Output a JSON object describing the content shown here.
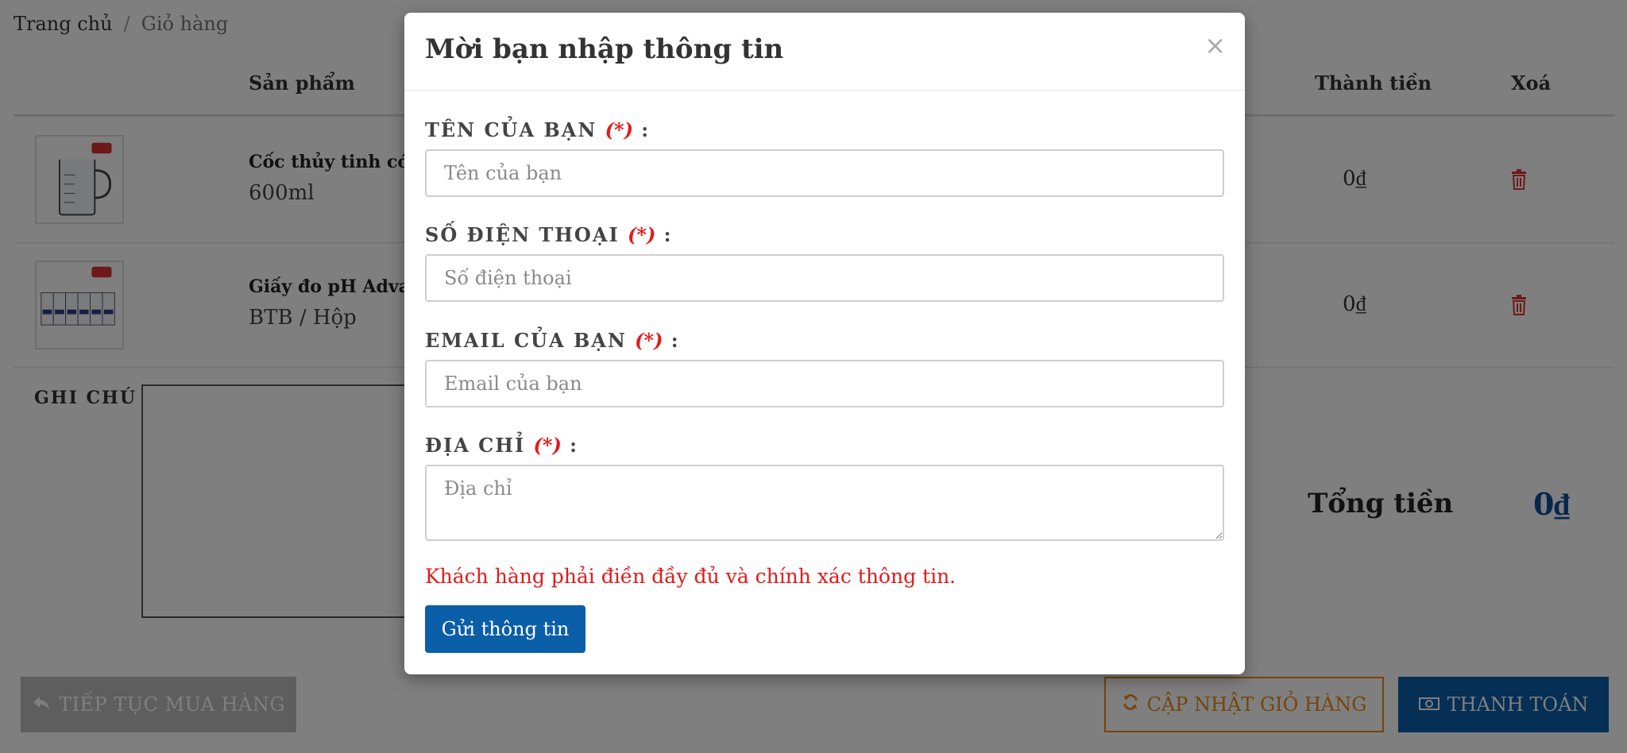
{
  "breadcrumb": {
    "home": "Trang chủ",
    "separator": "/",
    "current": "Giỏ hàng"
  },
  "table": {
    "headers": {
      "product": "Sản phẩm",
      "subtotal": "Thành tiền",
      "delete": "Xoá"
    },
    "rows": [
      {
        "name": "Cốc thủy tinh có q",
        "variant": "600ml",
        "subtotal": "0₫"
      },
      {
        "name": "Giấy đo pH Advan",
        "variant": "BTB / Hộp",
        "subtotal": "0₫"
      }
    ]
  },
  "note": {
    "label": "GHI CHÚ"
  },
  "total": {
    "label": "Tổng tiền",
    "value": "0₫"
  },
  "actions": {
    "continue_label": "TIẾP TỤC MUA HÀNG",
    "update_label": "CẬP NHẬT GIỎ HÀNG",
    "checkout_label": "THANH TOÁN"
  },
  "modal": {
    "title": "Mời bạn nhập thông tin",
    "close": "×",
    "required_mark": "(*)",
    "colon": ":",
    "fields": [
      {
        "label": "TÊN CỦA BẠN",
        "placeholder": "Tên của bạn"
      },
      {
        "label": "SỐ ĐIỆN THOẠI",
        "placeholder": "Số điện thoại"
      },
      {
        "label": "EMAIL CỦA BẠN",
        "placeholder": "Email của bạn"
      },
      {
        "label": "ĐỊA CHỈ",
        "placeholder": "Địa chỉ"
      }
    ],
    "warning": "Khách hàng phải điền đầy đủ và chính xác thông tin.",
    "submit_label": "Gửi thông tin"
  },
  "colors": {
    "primary": "#0b5ea8",
    "total_value": "#0b4f9e",
    "required": "#e21b1b",
    "update_button": "#e88a1a",
    "delete_icon": "#dd3333",
    "overlay": "rgba(0,0,0,0.5)"
  },
  "icons": {
    "delete": "trash-icon",
    "continue": "reply-icon",
    "update": "refresh-icon",
    "checkout": "money-icon",
    "close": "close-icon"
  }
}
